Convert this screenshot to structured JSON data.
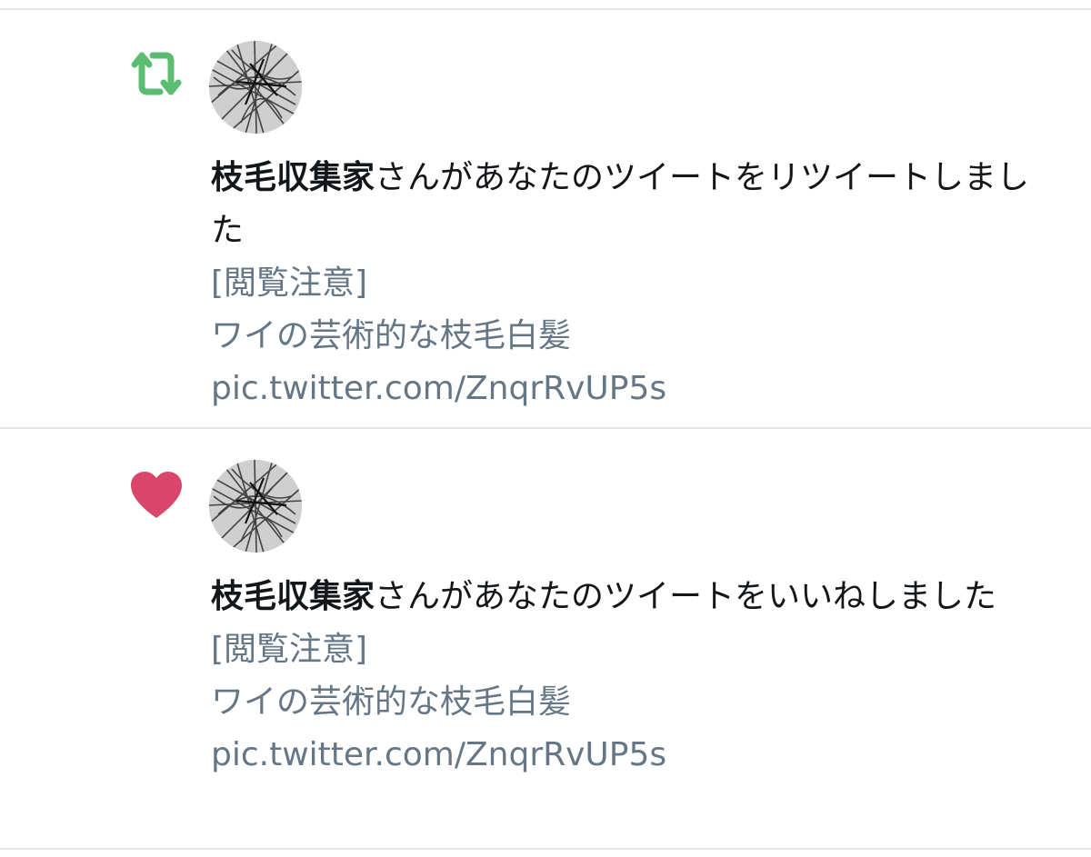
{
  "notifications": [
    {
      "type": "retweet",
      "icon": "retweet-icon",
      "icon_color": "#17bf63",
      "user_name": "枝毛収集家",
      "action_text": "さんがあなたのツイートをリツイートしました",
      "tweet_text": "[閲覧注意]\nワイの芸術的な枝毛白髪 pic.twitter.com/ZnqrRvUP5s"
    },
    {
      "type": "like",
      "icon": "heart-icon",
      "icon_color": "#e0245e",
      "user_name": "枝毛収集家",
      "action_text": "さんがあなたのツイートをいいねしました",
      "tweet_text": "[閲覧注意]\nワイの芸術的な枝毛白髪 pic.twitter.com/ZnqrRvUP5s"
    }
  ],
  "colors": {
    "primary_text": "#14171a",
    "secondary_text": "#657786",
    "divider": "#e1e4e8"
  }
}
